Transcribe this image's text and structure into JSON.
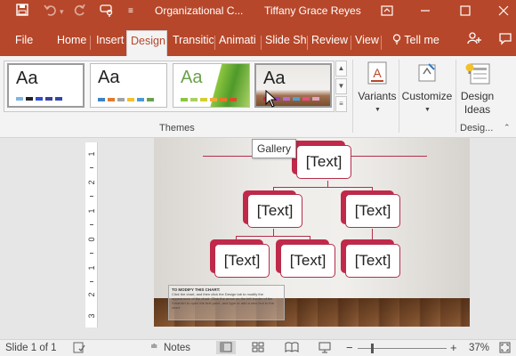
{
  "titlebar": {
    "doc_title": "Organizational C...",
    "user_name": "Tiffany Grace Reyes",
    "icons": [
      "save-icon",
      "undo-icon",
      "redo-icon",
      "touch-mode-icon",
      "customize-qat-icon",
      "ribbon-display-icon",
      "minimize-icon",
      "maximize-icon",
      "close-icon"
    ]
  },
  "tabs": [
    "File",
    "Home",
    "Insert",
    "Design",
    "Transitic",
    "Animati",
    "Slide Sho",
    "Review",
    "View"
  ],
  "active_tab": "Design",
  "tell_me": "Tell me",
  "ribbon": {
    "themes": [
      {
        "label": "Aa",
        "colors": [
          "#7fb5e6",
          "#222222",
          "#2e4bd1",
          "#3b3f9e",
          "#2d4aa8"
        ]
      },
      {
        "label": "Aa",
        "colors": [
          "#3b82c4",
          "#e07c2e",
          "#9ea3a8",
          "#f2c12e",
          "#4a9ad6",
          "#6ba04c"
        ]
      },
      {
        "label": "Aa",
        "colors": [
          "#8cc63f",
          "#a9d163",
          "#d2cf2f",
          "#f2a83b",
          "#e6762a",
          "#d94c2b"
        ]
      },
      {
        "label": "Aa",
        "colors": [
          "#c0294a",
          "#9b3fc4",
          "#b86bd6",
          "#4aa0d9",
          "#e84f7d",
          "#e0a3c1"
        ]
      }
    ],
    "group_themes": "Themes",
    "variants_label": "Variants",
    "customize_label": "Customize",
    "design_ideas_label_1": "Design",
    "design_ideas_label_2": "Ideas",
    "group_design": "Desig..."
  },
  "tooltip": "Gallery",
  "slide": {
    "nodes": [
      "[Text]",
      "[Text]",
      "[Text]",
      "[Text]",
      "[Text]",
      "[Text]"
    ],
    "note_title": "TO MODIFY THIS CHART:",
    "note_body": "Click the chart, and then click the Design tab to modify the appearance of the chart. Click the arrow on the left border of the SmartArt to open the text pane, and type or add a new text to the chart."
  },
  "ruler_numbers": [
    "1",
    "2",
    "1",
    "0",
    "1",
    "2",
    "3"
  ],
  "status": {
    "slide_info": "Slide 1 of 1",
    "notes": "Notes",
    "zoom": "37%",
    "zoom_level_fraction": 0.37
  },
  "colors": {
    "accent": "#b7472a",
    "node_red": "#c0294a"
  }
}
